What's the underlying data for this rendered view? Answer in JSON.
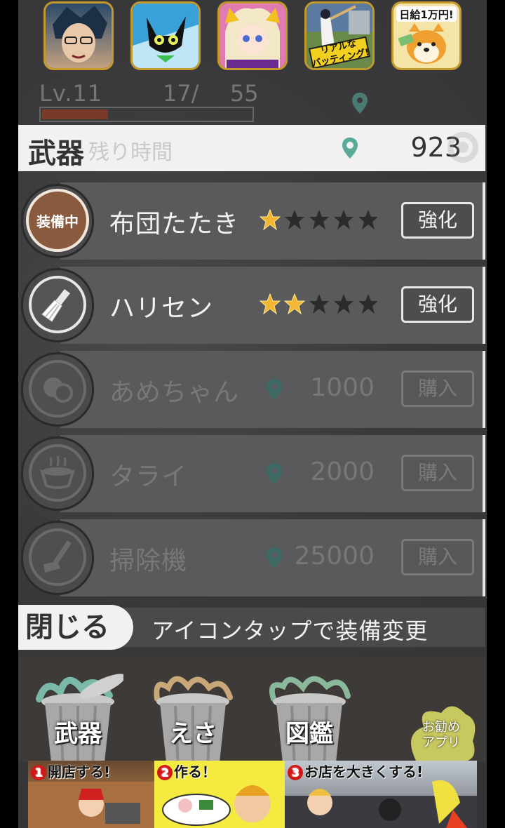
{
  "ads": {
    "icons": [
      {
        "name": "manga-character-ad-icon",
        "colors": [
          "#2a4a6a",
          "#1b2f45"
        ]
      },
      {
        "name": "black-cat-ad-icon",
        "colors": [
          "#3aa0d8",
          "#1f6fae"
        ]
      },
      {
        "name": "anime-girl-ad-icon",
        "colors": [
          "#7a3aa0",
          "#c05aa0"
        ]
      },
      {
        "name": "baseball-batting-ad-icon",
        "label": "リアルな\nバッティング!",
        "colors": [
          "#3a6a9a",
          "#6a8a4a"
        ]
      },
      {
        "name": "shiba-dog-ad-icon",
        "label": "日給1万円!",
        "colors": [
          "#f2e0a0",
          "#e8c870"
        ]
      }
    ]
  },
  "status": {
    "level": "Lv.11",
    "exp_current": "17/",
    "exp_max": "55",
    "exp_progress": 0.31
  },
  "header": {
    "title": "武器",
    "ghost_text": "残り時間",
    "coins": "923"
  },
  "weapons": [
    {
      "name": "布団たたき",
      "stars": 1,
      "max_stars": 5,
      "button": "強化",
      "equipped": true,
      "equipped_label": "装備中",
      "locked": false,
      "icon": "futon-beater-icon"
    },
    {
      "name": "ハリセン",
      "stars": 2,
      "max_stars": 5,
      "button": "強化",
      "equipped": false,
      "locked": false,
      "icon": "harisen-fan-icon"
    },
    {
      "name": "あめちゃん",
      "price": "1000",
      "button": "購入",
      "locked": true,
      "icon": "candy-icon"
    },
    {
      "name": "タライ",
      "price": "2000",
      "button": "購入",
      "locked": true,
      "icon": "washtub-icon"
    },
    {
      "name": "掃除機",
      "price": "25000",
      "button": "購入",
      "locked": true,
      "icon": "vacuum-cleaner-icon"
    }
  ],
  "closebar": {
    "close_label": "閉じる",
    "hint": "アイコンタップで装備変更"
  },
  "nav": {
    "items": [
      {
        "label": "武器"
      },
      {
        "label": "えさ"
      },
      {
        "label": "図鑑"
      }
    ],
    "recommend": "お勧め\nアプリ"
  },
  "banner": {
    "steps": [
      {
        "num": "1",
        "text": "開店する!"
      },
      {
        "num": "2",
        "text": "作る！"
      },
      {
        "num": "3",
        "text": "お店を大きくする!"
      }
    ]
  },
  "colors": {
    "star_on": "#f2b632",
    "star_off": "#2b2b2b",
    "equip_badge": "#8a5a3e",
    "gem": "#4a9a8a"
  }
}
